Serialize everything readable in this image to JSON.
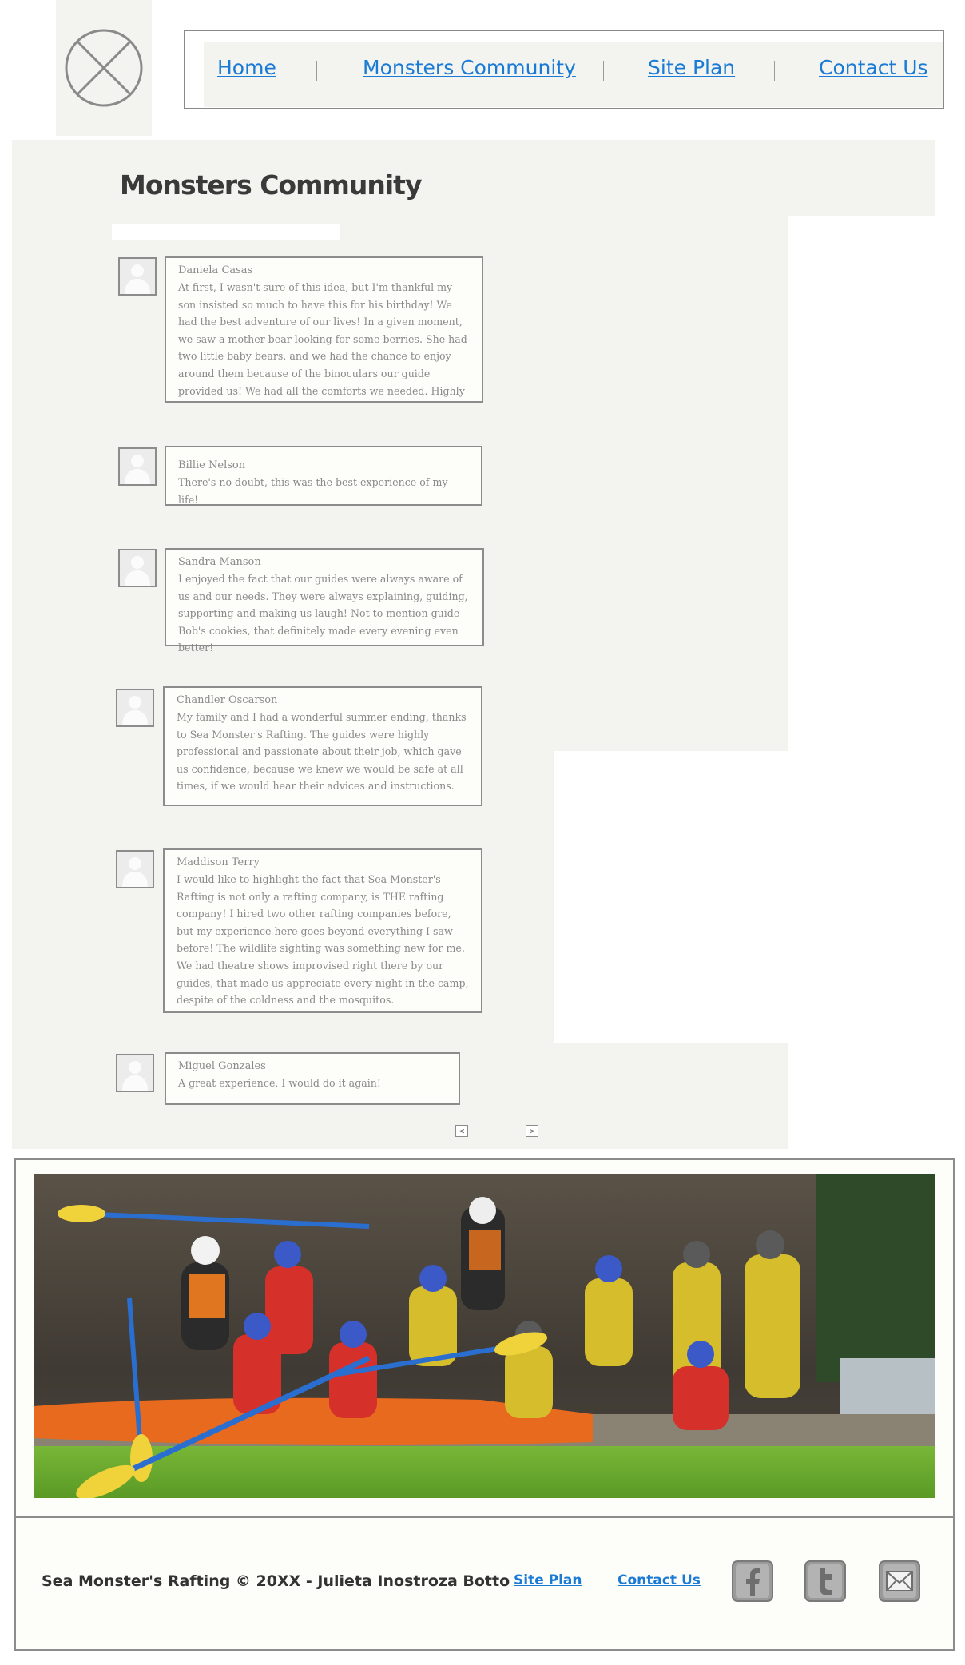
{
  "nav": {
    "items": [
      "Home",
      "Monsters Community",
      "Site Plan",
      "Contact Us"
    ]
  },
  "page": {
    "title": "Monsters Community"
  },
  "comments": [
    {
      "name": "Daniela Casas",
      "text": "At first, I wasn't sure of this idea, but I'm thankful my son insisted so much to have this for his birthday! We had the best adventure of our lives! In a given moment, we saw a mother bear looking for some berries. She had two little baby bears, and we had the chance to enjoy around them because of the binoculars our guide provided us! We had all the comforts we needed. Highly recommended!"
    },
    {
      "name": "Billie Nelson",
      "text": "There's no doubt, this was the best experience of my life!"
    },
    {
      "name": "Sandra Manson",
      "text": "I enjoyed the fact that our guides were always aware of us and our needs. They were always explaining, guiding, supporting and making us laugh! Not to mention guide Bob's cookies, that definitely made every evening even better!"
    },
    {
      "name": "Chandler Oscarson",
      "text": "My family and I had a wonderful summer ending, thanks to Sea Monster's Rafting. The guides were highly professional and passionate about their job, which gave us confidence, because we knew we would be safe at all times, if we would hear their advices and instructions."
    },
    {
      "name": "Maddison Terry",
      "text": "I would like to highlight the fact that Sea Monster's Rafting is not only a rafting company, is THE rafting company! I hired two other rafting companies before, but my experience here goes beyond everything I saw before! The wildlife sighting was something new for me. We had theatre shows improvised right there by our guides, that made us appreciate every night in the camp, despite of the coldness and the mosquitos."
    },
    {
      "name": "Miguel Gonzales",
      "text": "A great experience, I would do it again!"
    }
  ],
  "pager": {
    "prev": "<",
    "next": ">"
  },
  "footer": {
    "copyright": "Sea Monster's Rafting © 20XX - Julieta Inostroza Botto",
    "links": [
      "Site Plan",
      "Contact Us"
    ],
    "social": [
      "facebook-icon",
      "twitter-icon",
      "mail-icon"
    ]
  },
  "colors": {
    "link": "#1a7bd6",
    "panel": "#f3f3ef",
    "border": "#8c8c8c",
    "text_muted": "#8a8a8a"
  }
}
